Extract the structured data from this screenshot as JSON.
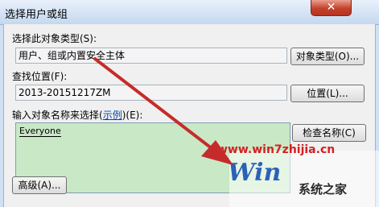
{
  "window": {
    "title": "选择用户或组",
    "close_glyph": "✕"
  },
  "object_type": {
    "label": "选择此对象类型(S):",
    "value": "用户、组或内置安全主体",
    "button": "对象类型(O)..."
  },
  "location": {
    "label": "查找位置(F):",
    "value": "2013-20151217ZM",
    "button": "位置(L)..."
  },
  "names": {
    "label_pre": "输入对象名称来选择(",
    "label_link": "示例",
    "label_post": ")(E):",
    "entries": [
      "Everyone"
    ],
    "check_button": "检查名称(C)"
  },
  "advanced_button": "高级(A)...",
  "watermark": {
    "url": "www.win7zhijia.cn",
    "logo_text": "Win",
    "site_name": "系统之家"
  },
  "colors": {
    "arrow": "#c62b2b",
    "input_highlight": "#c9e8c6",
    "close_button": "#c3412c"
  }
}
